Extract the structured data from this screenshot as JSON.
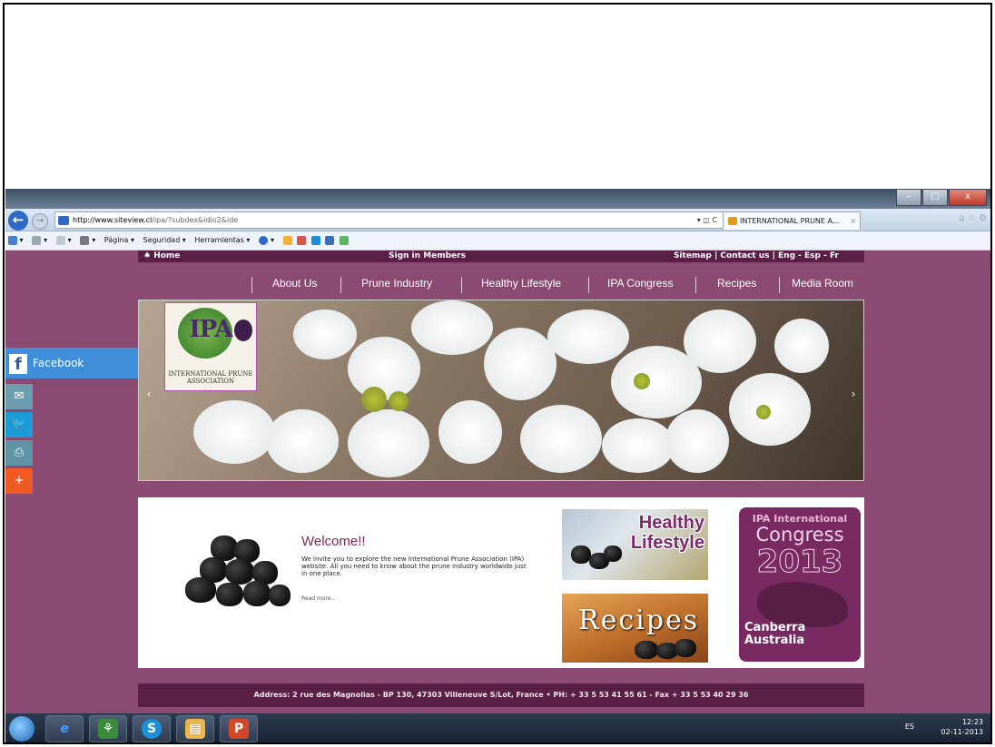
{
  "browser": {
    "url_host": "http://www.siteview.cl",
    "url_path": "/ipa/?subdex&idio2&ide",
    "tab_title": "INTERNATIONAL PRUNE A...",
    "tab_close": "×",
    "addr_controls": "▾ ◫ C",
    "back_icon": "←",
    "fwd_icon": "→",
    "window_controls": [
      "–",
      "▢",
      "x"
    ],
    "command_bar": [
      {
        "icon": "home-icon",
        "label": "▾"
      },
      {
        "icon": "feeds-icon",
        "label": "▾"
      },
      {
        "icon": "mail-icon",
        "label": "▾"
      },
      {
        "icon": "print-icon",
        "label": "▾"
      },
      {
        "icon": "page-icon",
        "label": "Página ▾"
      },
      {
        "icon": "safety-icon",
        "label": "Seguridad ▾"
      },
      {
        "icon": "tools-icon",
        "label": "Herramientas ▾"
      },
      {
        "icon": "help-icon",
        "label": "▾"
      }
    ]
  },
  "site": {
    "top": {
      "home": "♠ Home",
      "sign_in": "Sign in Members",
      "links": "Sitemap  |  Contact us  |  Eng  -  Esp  -  Fr"
    },
    "menu": [
      "About Us",
      "Prune Industry",
      "Healthy Lifestyle",
      "IPA Congress",
      "Recipes",
      "Media Room"
    ],
    "logo": {
      "abbr": "IPA",
      "caption": "INTERNATIONAL PRUNE ASSOCIATION"
    },
    "slider_prev": "‹",
    "slider_next": "›",
    "welcome": {
      "title": "Welcome!!",
      "body": "We invite you to explore the new International Prune Association (IPA) website. All you need to know about the prune industry worldwide just in one place.",
      "read_more": "Read more..."
    },
    "tiles": {
      "healthy": "Healthy Lifestyle",
      "recipes": "Recipes",
      "congress_line1": "IPA International",
      "congress_line2": "Congress",
      "congress_year": "2013",
      "congress_city": "Canberra",
      "congress_country": "Australia"
    },
    "footer": "Address: 2 rue des Magnolias - BP 130, 47303 Villeneuve S/Lot, France • PH: + 33 5 53 41 55 61 - Fax + 33 5 53 40 29 36",
    "social": {
      "facebook": "Facebook",
      "colors": {
        "facebook": "#3f8ed8",
        "email": "#6b9cb0",
        "twitter": "#1d9bd7",
        "print": "#5f93a5",
        "share": "#f05a24"
      }
    }
  },
  "taskbar": {
    "lang": "ES",
    "time": "12:23",
    "date": "02-11-2013",
    "apps": [
      "internet-explorer-icon",
      "network-icon",
      "skype-icon",
      "explorer-folder-icon",
      "powerpoint-icon"
    ]
  },
  "colors": {
    "brand": "#5a1f45",
    "page_bg": "#8a4a72",
    "menu_text": "#ffffff"
  }
}
